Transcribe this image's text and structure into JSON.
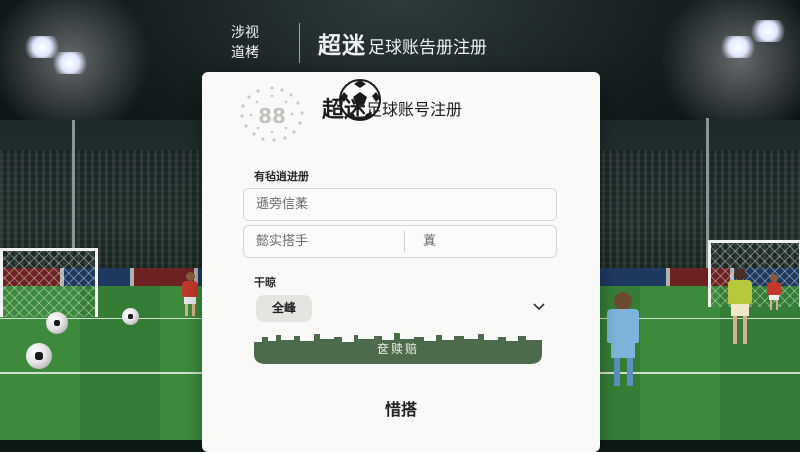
{
  "header": {
    "brand_line1": "涉视",
    "brand_line2": "道栲",
    "title_big": "超迷",
    "title_small": "足球账告册注册"
  },
  "card": {
    "title_big": "超迷",
    "title_small": "足球账号注册",
    "logo_digits": "88",
    "section_label_1": "有毡逍进册",
    "field_1_placeholder": "遜旁信葇",
    "field_2a_placeholder": "懿实搭手",
    "field_2b_placeholder": "蒖",
    "section_label_2": "干晾",
    "select_value": "全峰",
    "submit_label": "奁赎赔",
    "bottom_link": "惜搭"
  },
  "colors": {
    "submit": "#4d6a4c",
    "card_bg": "#f9f9f7",
    "pitch": "#3d8a3c"
  },
  "icons": {
    "chevron": "chevron-down-icon",
    "ball": "soccer-ball-icon",
    "logo": "dotted-circle-logo"
  }
}
